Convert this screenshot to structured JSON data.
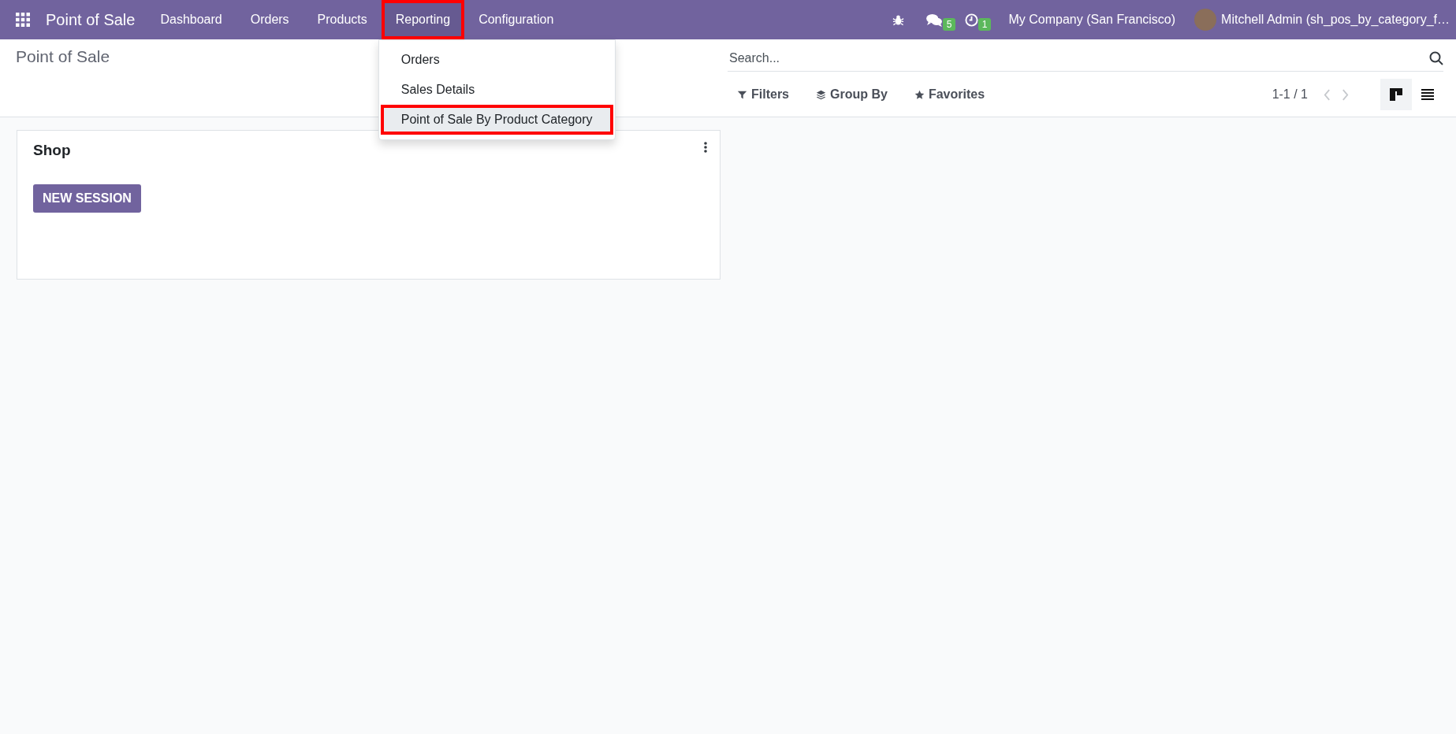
{
  "navbar": {
    "app_name": "Point of Sale",
    "menus": [
      {
        "label": "Dashboard",
        "selected": false,
        "highlighted": false
      },
      {
        "label": "Orders",
        "selected": false,
        "highlighted": false
      },
      {
        "label": "Products",
        "selected": false,
        "highlighted": false
      },
      {
        "label": "Reporting",
        "selected": true,
        "highlighted": true,
        "expanded": true,
        "items": [
          {
            "label": "Orders",
            "selected": false,
            "highlighted": false
          },
          {
            "label": "Sales Details",
            "selected": false,
            "highlighted": false
          },
          {
            "label": "Point of Sale By Product Category",
            "selected": true,
            "highlighted": true
          }
        ]
      },
      {
        "label": "Configuration",
        "selected": false,
        "highlighted": false
      }
    ],
    "messages_count": "5",
    "activities_count": "1",
    "company": "My Company (San Francisco)",
    "user": "Mitchell Admin (sh_pos_by_category_f…"
  },
  "control_panel": {
    "title": "Point of Sale",
    "search": {
      "placeholder": "Search..."
    },
    "filters": [
      {
        "label": "Filters",
        "kind": "filter"
      },
      {
        "label": "Group By",
        "kind": "group"
      },
      {
        "label": "Favorites",
        "kind": "star"
      }
    ],
    "pager": "1-1 / 1",
    "views": [
      {
        "kind": "kanban",
        "selected": true
      },
      {
        "kind": "list",
        "selected": false
      }
    ]
  },
  "cards": [
    {
      "title": "Shop",
      "button": "NEW SESSION"
    }
  ]
}
